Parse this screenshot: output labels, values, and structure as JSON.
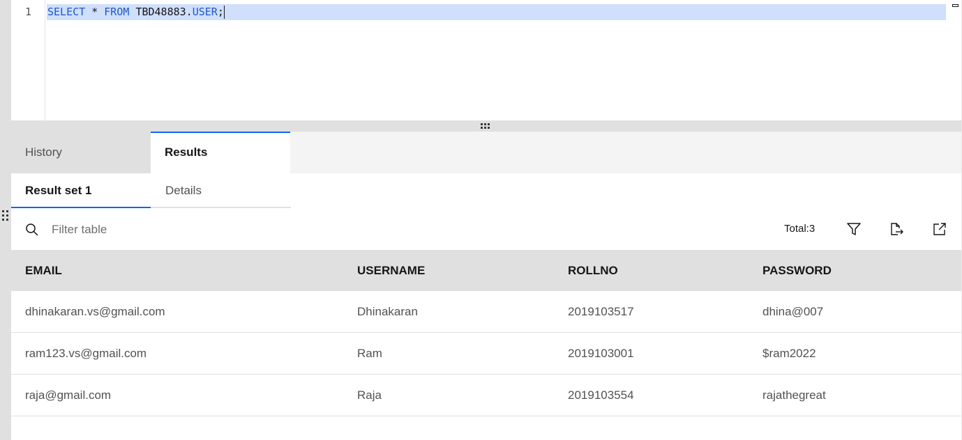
{
  "editor": {
    "line_number": "1",
    "code": {
      "kw_select": "SELECT",
      "star": "*",
      "kw_from": "FROM",
      "schema": "TBD48883.",
      "table": "USER",
      "end": ";"
    }
  },
  "tabs": {
    "history": "History",
    "results": "Results"
  },
  "subtabs": {
    "result_set": "Result set 1",
    "details": "Details"
  },
  "toolbar": {
    "filter_placeholder": "Filter table",
    "total_label": "Total:3"
  },
  "table": {
    "columns": [
      "EMAIL",
      "USERNAME",
      "ROLLNO",
      "PASSWORD"
    ],
    "rows": [
      [
        "dhinakaran.vs@gmail.com",
        "Dhinakaran",
        "2019103517",
        "dhina@007"
      ],
      [
        "ram123.vs@gmail.com",
        "Ram",
        "2019103001",
        "$ram2022"
      ],
      [
        "raja@gmail.com",
        "Raja",
        "2019103554",
        "rajathegreat"
      ]
    ]
  },
  "colors": {
    "accent": "#0f62fe",
    "selection": "#cfdffc",
    "keyword": "#1f57c9"
  },
  "icons": [
    "search-icon",
    "filter-icon",
    "export-icon",
    "popout-icon",
    "drag-handle-icon",
    "minimize-icon"
  ]
}
